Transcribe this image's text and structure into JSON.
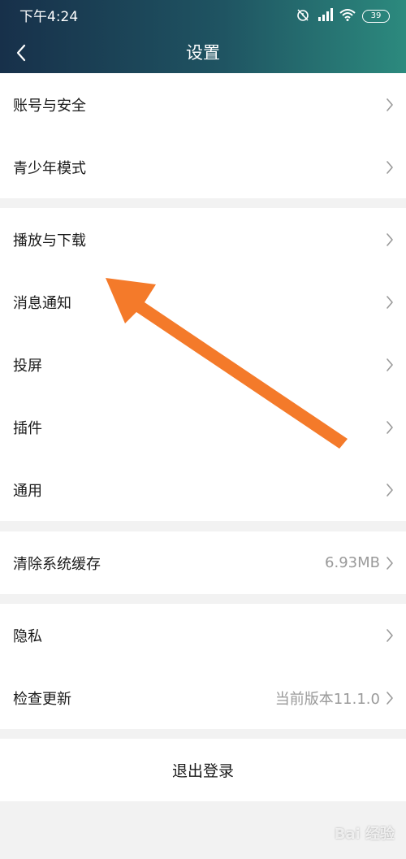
{
  "status_bar": {
    "time": "下午4:24",
    "battery": "39"
  },
  "header": {
    "title": "设置"
  },
  "groups": [
    {
      "items": [
        {
          "label": "账号与安全",
          "value": ""
        },
        {
          "label": "青少年模式",
          "value": ""
        }
      ]
    },
    {
      "items": [
        {
          "label": "播放与下载",
          "value": ""
        },
        {
          "label": "消息通知",
          "value": ""
        },
        {
          "label": "投屏",
          "value": ""
        },
        {
          "label": "插件",
          "value": ""
        },
        {
          "label": "通用",
          "value": ""
        }
      ]
    },
    {
      "items": [
        {
          "label": "清除系统缓存",
          "value": "6.93MB"
        }
      ]
    },
    {
      "items": [
        {
          "label": "隐私",
          "value": ""
        },
        {
          "label": "检查更新",
          "value": "当前版本11.1.0"
        }
      ]
    }
  ],
  "logout": {
    "label": "退出登录"
  },
  "annotation": {
    "arrow_color": "#f47a2a",
    "icon": "arrow-pointer-icon"
  },
  "watermark": {
    "text": "Bai 经验"
  },
  "colors": {
    "header_gradient_start": "#17304a",
    "header_gradient_end": "#2c8a7e",
    "page_background": "#f2f2f2",
    "secondary_text": "#9a9a9a"
  }
}
